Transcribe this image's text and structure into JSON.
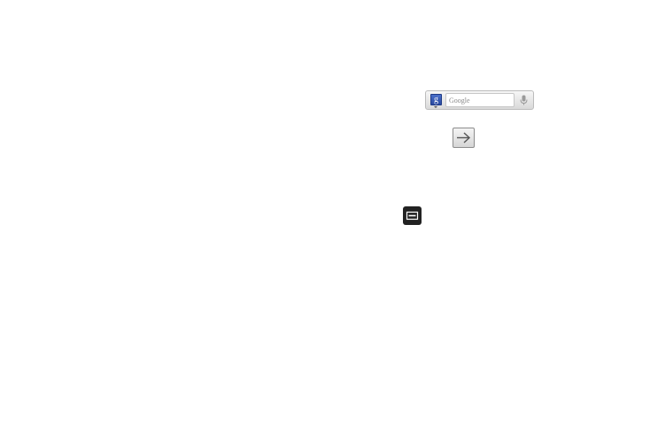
{
  "search_widget": {
    "placeholder": "Google",
    "provider_icon": "google-g-icon",
    "voice_icon": "microphone-icon",
    "accent_color": "#3a5bb8"
  },
  "keys": {
    "arrow": {
      "icon": "arrow-right-icon"
    },
    "menu": {
      "icon": "menu-icon"
    }
  }
}
